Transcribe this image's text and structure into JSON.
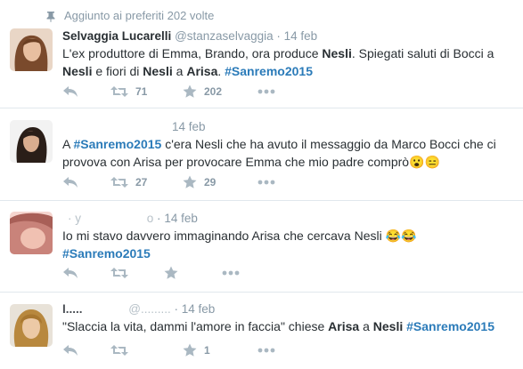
{
  "colors": {
    "meta_gray": "#8899a6",
    "hashtag_blue": "#2b7bb9",
    "text": "#292f33",
    "divider": "#e1e8ed"
  },
  "context_line": {
    "icon": "pin-icon",
    "text": "Aggiunto ai preferiti 202 volte"
  },
  "tweets": [
    {
      "name": "Selvaggia Lucarelli",
      "handle": "@stanzaselvaggia",
      "sep": "·",
      "time": "14 feb",
      "text": {
        "p1": "L'ex produttore di Emma, Brando, ora produce ",
        "b1": "Nesli",
        "p2": ". Spiegati saluti di Bocci a ",
        "b2": "Nesli",
        "p3": " e fiori di ",
        "b3": "Nesli",
        "p4": " a ",
        "b4": "Arisa",
        "p5": ". ",
        "hashtag": "#Sanremo2015"
      },
      "retweets": "71",
      "favorites": "202"
    },
    {
      "time": "14 feb",
      "text": {
        "p1": "A ",
        "hashtag": "#Sanremo2015",
        "p2": " c'era Nesli che ha avuto il messaggio da Marco Bocci che ci provova con Arisa per provocare Emma che mio padre comprò",
        "emoji": "😮😑"
      },
      "retweets": "27",
      "favorites": "29"
    },
    {
      "name_fragment": "· y",
      "handle_fragment": "o",
      "sep": "·",
      "time": "14 feb",
      "text": {
        "p1": "Io mi stavo davvero immaginando Arisa che cercava Nesli",
        "emoji": "😂😂",
        "hashtag": "#Sanremo2015"
      },
      "retweets": "",
      "favorites": ""
    },
    {
      "name_fragment": "I.....",
      "handle_fragment": "@.........",
      "sep": "·",
      "time": "14 feb",
      "text": {
        "p1": "\"Slaccia la vita, dammi l'amore in faccia\" chiese ",
        "b1": "Arisa",
        "p2": " a ",
        "b2": "Nesli",
        "p3": " ",
        "hashtag": "#Sanremo2015"
      },
      "retweets": "",
      "favorites": "1"
    }
  ]
}
